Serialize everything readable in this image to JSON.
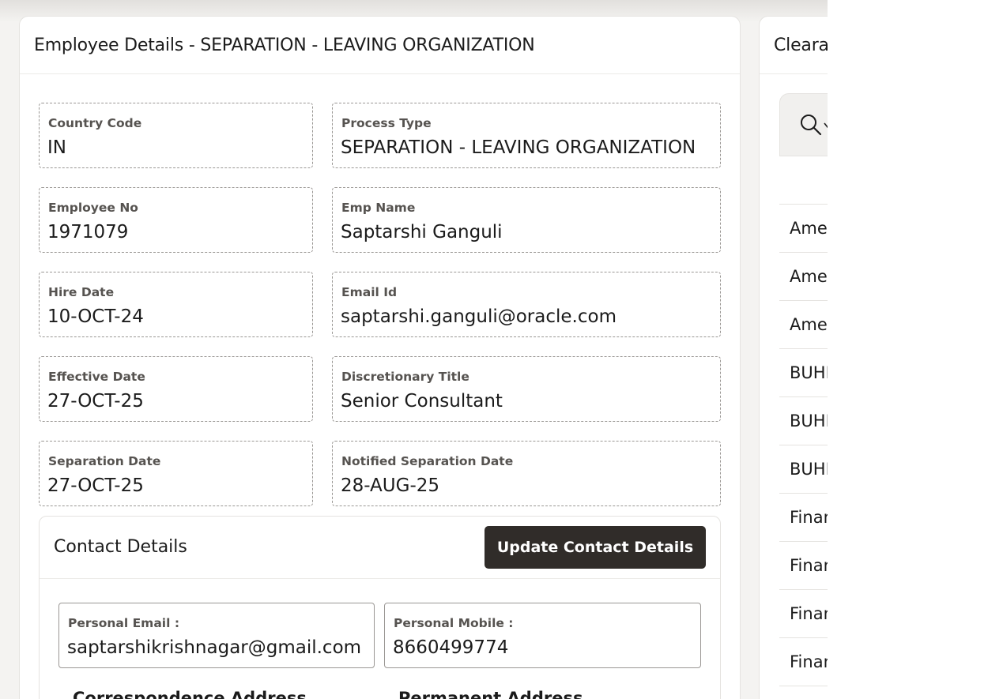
{
  "employee_card": {
    "title": "Employee Details - SEPARATION - LEAVING ORGANIZATION",
    "fields": [
      {
        "label": "Country Code",
        "value": "IN"
      },
      {
        "label": "Process Type",
        "value": "SEPARATION - LEAVING ORGANIZATION"
      },
      {
        "label": "Employee No",
        "value": "1971079"
      },
      {
        "label": "Emp Name",
        "value": "Saptarshi Ganguli"
      },
      {
        "label": "Hire Date",
        "value": "10-OCT-24"
      },
      {
        "label": "Email Id",
        "value": "saptarshi.ganguli@oracle.com"
      },
      {
        "label": "Effective Date",
        "value": "27-OCT-25"
      },
      {
        "label": "Discretionary Title",
        "value": "Senior Consultant"
      },
      {
        "label": "Separation Date",
        "value": "27-OCT-25"
      },
      {
        "label": "Notified Separation Date",
        "value": "28-AUG-25"
      }
    ]
  },
  "contact": {
    "title": "Contact Details",
    "update_button": "Update Contact Details",
    "personal_email_label": "Personal Email :",
    "personal_email_value": "saptarshikrishnagar@gmail.com",
    "personal_mobile_label": "Personal Mobile :",
    "personal_mobile_value": "8660499774",
    "correspondence_label": "Correspondence Address",
    "permanent_label": "Permanent Address"
  },
  "clearance_card": {
    "title": "Clearance",
    "rows": [
      "Amex",
      "Amex",
      "Amex",
      "BUHR",
      "BUHR",
      "BUHR",
      "Finance",
      "Finance",
      "Finance",
      "Finance"
    ]
  },
  "icons": {
    "search": "search-icon"
  }
}
